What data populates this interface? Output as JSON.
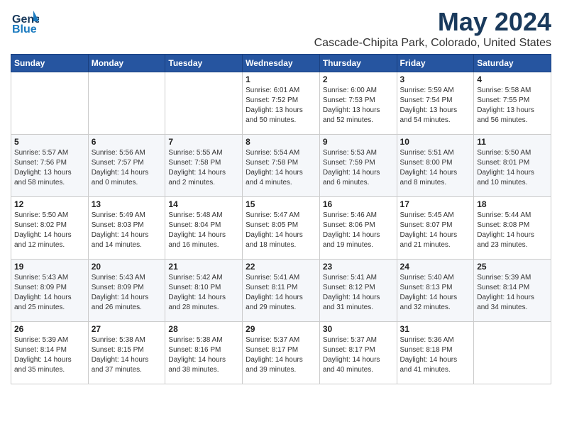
{
  "header": {
    "logo_line1": "General",
    "logo_line2": "Blue",
    "month": "May 2024",
    "location": "Cascade-Chipita Park, Colorado, United States"
  },
  "weekdays": [
    "Sunday",
    "Monday",
    "Tuesday",
    "Wednesday",
    "Thursday",
    "Friday",
    "Saturday"
  ],
  "weeks": [
    [
      {
        "day": "",
        "info": ""
      },
      {
        "day": "",
        "info": ""
      },
      {
        "day": "",
        "info": ""
      },
      {
        "day": "1",
        "info": "Sunrise: 6:01 AM\nSunset: 7:52 PM\nDaylight: 13 hours\nand 50 minutes."
      },
      {
        "day": "2",
        "info": "Sunrise: 6:00 AM\nSunset: 7:53 PM\nDaylight: 13 hours\nand 52 minutes."
      },
      {
        "day": "3",
        "info": "Sunrise: 5:59 AM\nSunset: 7:54 PM\nDaylight: 13 hours\nand 54 minutes."
      },
      {
        "day": "4",
        "info": "Sunrise: 5:58 AM\nSunset: 7:55 PM\nDaylight: 13 hours\nand 56 minutes."
      }
    ],
    [
      {
        "day": "5",
        "info": "Sunrise: 5:57 AM\nSunset: 7:56 PM\nDaylight: 13 hours\nand 58 minutes."
      },
      {
        "day": "6",
        "info": "Sunrise: 5:56 AM\nSunset: 7:57 PM\nDaylight: 14 hours\nand 0 minutes."
      },
      {
        "day": "7",
        "info": "Sunrise: 5:55 AM\nSunset: 7:58 PM\nDaylight: 14 hours\nand 2 minutes."
      },
      {
        "day": "8",
        "info": "Sunrise: 5:54 AM\nSunset: 7:58 PM\nDaylight: 14 hours\nand 4 minutes."
      },
      {
        "day": "9",
        "info": "Sunrise: 5:53 AM\nSunset: 7:59 PM\nDaylight: 14 hours\nand 6 minutes."
      },
      {
        "day": "10",
        "info": "Sunrise: 5:51 AM\nSunset: 8:00 PM\nDaylight: 14 hours\nand 8 minutes."
      },
      {
        "day": "11",
        "info": "Sunrise: 5:50 AM\nSunset: 8:01 PM\nDaylight: 14 hours\nand 10 minutes."
      }
    ],
    [
      {
        "day": "12",
        "info": "Sunrise: 5:50 AM\nSunset: 8:02 PM\nDaylight: 14 hours\nand 12 minutes."
      },
      {
        "day": "13",
        "info": "Sunrise: 5:49 AM\nSunset: 8:03 PM\nDaylight: 14 hours\nand 14 minutes."
      },
      {
        "day": "14",
        "info": "Sunrise: 5:48 AM\nSunset: 8:04 PM\nDaylight: 14 hours\nand 16 minutes."
      },
      {
        "day": "15",
        "info": "Sunrise: 5:47 AM\nSunset: 8:05 PM\nDaylight: 14 hours\nand 18 minutes."
      },
      {
        "day": "16",
        "info": "Sunrise: 5:46 AM\nSunset: 8:06 PM\nDaylight: 14 hours\nand 19 minutes."
      },
      {
        "day": "17",
        "info": "Sunrise: 5:45 AM\nSunset: 8:07 PM\nDaylight: 14 hours\nand 21 minutes."
      },
      {
        "day": "18",
        "info": "Sunrise: 5:44 AM\nSunset: 8:08 PM\nDaylight: 14 hours\nand 23 minutes."
      }
    ],
    [
      {
        "day": "19",
        "info": "Sunrise: 5:43 AM\nSunset: 8:09 PM\nDaylight: 14 hours\nand 25 minutes."
      },
      {
        "day": "20",
        "info": "Sunrise: 5:43 AM\nSunset: 8:09 PM\nDaylight: 14 hours\nand 26 minutes."
      },
      {
        "day": "21",
        "info": "Sunrise: 5:42 AM\nSunset: 8:10 PM\nDaylight: 14 hours\nand 28 minutes."
      },
      {
        "day": "22",
        "info": "Sunrise: 5:41 AM\nSunset: 8:11 PM\nDaylight: 14 hours\nand 29 minutes."
      },
      {
        "day": "23",
        "info": "Sunrise: 5:41 AM\nSunset: 8:12 PM\nDaylight: 14 hours\nand 31 minutes."
      },
      {
        "day": "24",
        "info": "Sunrise: 5:40 AM\nSunset: 8:13 PM\nDaylight: 14 hours\nand 32 minutes."
      },
      {
        "day": "25",
        "info": "Sunrise: 5:39 AM\nSunset: 8:14 PM\nDaylight: 14 hours\nand 34 minutes."
      }
    ],
    [
      {
        "day": "26",
        "info": "Sunrise: 5:39 AM\nSunset: 8:14 PM\nDaylight: 14 hours\nand 35 minutes."
      },
      {
        "day": "27",
        "info": "Sunrise: 5:38 AM\nSunset: 8:15 PM\nDaylight: 14 hours\nand 37 minutes."
      },
      {
        "day": "28",
        "info": "Sunrise: 5:38 AM\nSunset: 8:16 PM\nDaylight: 14 hours\nand 38 minutes."
      },
      {
        "day": "29",
        "info": "Sunrise: 5:37 AM\nSunset: 8:17 PM\nDaylight: 14 hours\nand 39 minutes."
      },
      {
        "day": "30",
        "info": "Sunrise: 5:37 AM\nSunset: 8:17 PM\nDaylight: 14 hours\nand 40 minutes."
      },
      {
        "day": "31",
        "info": "Sunrise: 5:36 AM\nSunset: 8:18 PM\nDaylight: 14 hours\nand 41 minutes."
      },
      {
        "day": "",
        "info": ""
      }
    ]
  ]
}
